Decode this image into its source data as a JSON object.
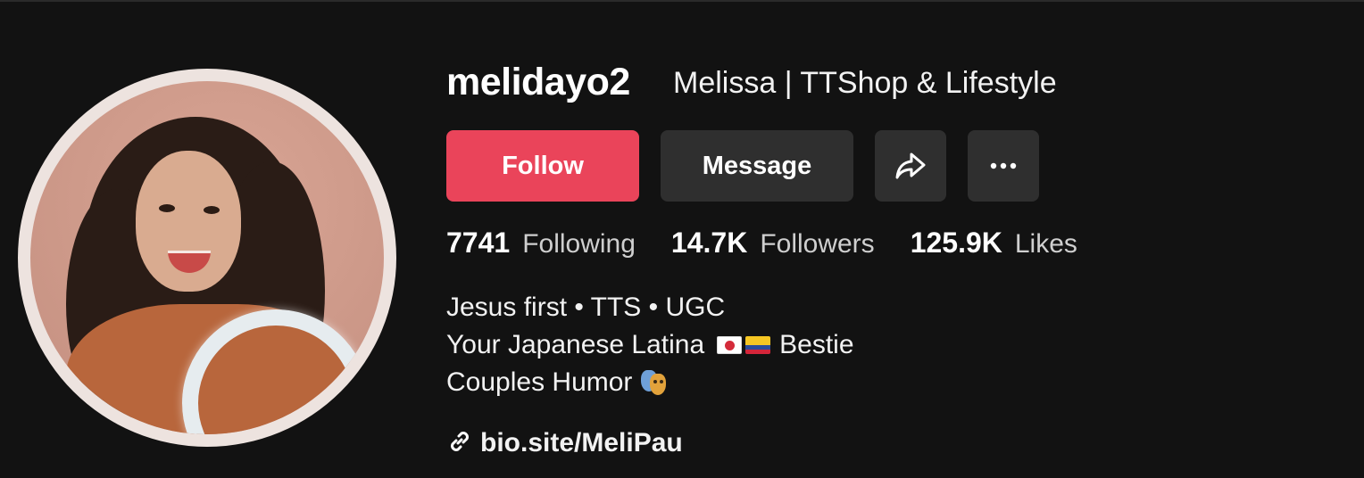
{
  "profile": {
    "username": "melidayo2",
    "display_name": "Melissa | TTShop & Lifestyle"
  },
  "actions": {
    "follow_label": "Follow",
    "message_label": "Message",
    "share_icon": "share-arrow-icon",
    "more_icon": "more-dots-icon"
  },
  "stats": {
    "following": {
      "value": "7741",
      "label": "Following"
    },
    "followers": {
      "value": "14.7K",
      "label": "Followers"
    },
    "likes": {
      "value": "125.9K",
      "label": "Likes"
    }
  },
  "bio": {
    "line1": "Jesus first • TTS • UGC",
    "line2_prefix": "Your Japanese Latina",
    "line2_suffix": "Bestie",
    "line3": "Couples Humor",
    "line3_icon": "performing-arts-masks-icon",
    "line2_icons": [
      "flag-japan-icon",
      "flag-colombia-icon"
    ]
  },
  "link": {
    "icon": "link-icon",
    "text": "bio.site/MeliPau"
  },
  "colors": {
    "background": "#121212",
    "follow_button": "#ea445a",
    "secondary_button": "#2f2f2f",
    "muted_text": "#cfcfcf"
  }
}
